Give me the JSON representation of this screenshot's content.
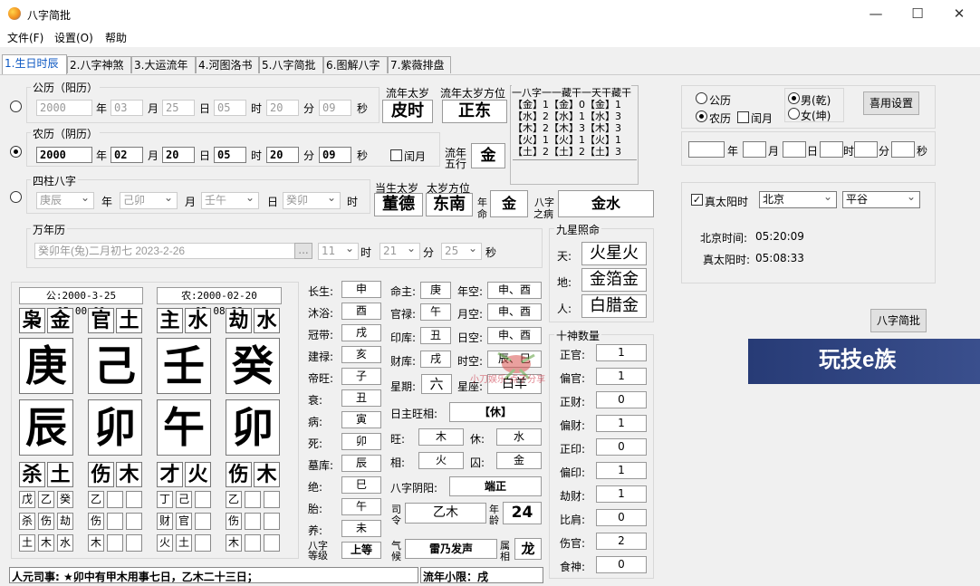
{
  "window": {
    "title": "八字简批",
    "min": "—",
    "max": "☐",
    "close": "✕"
  },
  "menu": [
    "文件(F)",
    "设置(O)",
    "帮助"
  ],
  "tabs": [
    "1.生日时辰",
    "2.八字神煞",
    "3.大运流年",
    "4.河图洛书",
    "5.八字简批",
    "6.图解八字",
    "7.紫薇排盘"
  ],
  "solar": {
    "title": "公历（阳历）",
    "year": "2000",
    "month": "03",
    "day": "25",
    "hour": "05",
    "minute": "20",
    "second": "09"
  },
  "lunar": {
    "title": "农历（阴历）",
    "year": "2000",
    "month": "02",
    "day": "20",
    "hour": "05",
    "minute": "20",
    "second": "09",
    "leap": "闰月"
  },
  "units": {
    "year": "年",
    "month": "月",
    "day": "日",
    "hour": "时",
    "minute": "分",
    "second": "秒"
  },
  "pillars_box": {
    "title": "四柱八字",
    "year": "庚辰",
    "month": "己卯",
    "day": "壬午",
    "hour": "癸卯"
  },
  "wannian": {
    "title": "万年历",
    "date": "癸卯年(兔)二月初七  2023-2-26",
    "ellipsis": "...",
    "hour": "11",
    "minute": "21",
    "second": "25"
  },
  "liunian": {
    "taisui_label": "流年太岁",
    "taisui": "皮时",
    "fangwei_label": "流年太岁方位",
    "fangwei": "正东",
    "wuxing_label1": "流年",
    "wuxing_label2": "五行",
    "wuxing": "金"
  },
  "canggan": {
    "header": "一八字一一藏干一天干藏干",
    "rows": [
      "【金】1【金】0【金】1",
      "【水】2【水】1【水】3",
      "【木】2【木】3【木】3",
      "【火】1【火】1【火】1",
      "【土】2【土】2【土】3"
    ]
  },
  "dangsheng": {
    "taisui_label": "当生太岁",
    "taisui": "董德",
    "fangwei_label": "太岁方位",
    "fangwei": "东南",
    "nianming_label1": "年",
    "nianming_label2": "命",
    "nianming": "金",
    "zhibing_label1": "八字",
    "zhibing_label2": "之病",
    "zhibing": "金水"
  },
  "right_settings": {
    "solar": "公历",
    "lunar": "农历",
    "leap": "闰月",
    "male": "男(乾)",
    "female": "女(坤)",
    "settings_btn": "喜用设置",
    "true_solar": "真太阳时",
    "city": "北京",
    "area": "平谷",
    "bj_label": "北京时间:",
    "bj_time": "05:20:09",
    "ts_label": "真太阳时:",
    "ts_time": "05:08:33",
    "brief_btn": "八字简批"
  },
  "ad": {
    "text": "玩技e族"
  },
  "chart": {
    "gong": "公:2000-3-25 05:00:00",
    "nong": "农:2000-02-20 05:08:33",
    "shishen_top": [
      [
        "枭",
        "金"
      ],
      [
        "官",
        "土"
      ],
      [
        "主",
        "水"
      ],
      [
        "劫",
        "水"
      ]
    ],
    "gan": [
      "庚",
      "己",
      "壬",
      "癸"
    ],
    "zhi": [
      "辰",
      "卯",
      "午",
      "卯"
    ],
    "shishen_bot": [
      [
        "杀",
        "土"
      ],
      [
        "伤",
        "木"
      ],
      [
        "才",
        "火"
      ],
      [
        "伤",
        "木"
      ]
    ],
    "hidden_row1": [
      [
        "戊",
        "乙",
        "癸"
      ],
      [
        "乙",
        "",
        ""
      ],
      [
        "丁",
        "己",
        ""
      ],
      [
        "乙",
        "",
        ""
      ]
    ],
    "hidden_row2": [
      [
        "杀",
        "伤",
        "劫"
      ],
      [
        "伤",
        "",
        ""
      ],
      [
        "财",
        "官",
        ""
      ],
      [
        "伤",
        "",
        ""
      ]
    ],
    "hidden_row3": [
      [
        "土",
        "木",
        "水"
      ],
      [
        "木",
        "",
        ""
      ],
      [
        "火",
        "土",
        ""
      ],
      [
        "木",
        "",
        ""
      ]
    ]
  },
  "changsheng": {
    "labels": [
      "长生:",
      "沐浴:",
      "冠带:",
      "建禄:",
      "帝旺:",
      "衰:",
      "病:",
      "死:",
      "墓库:",
      "绝:",
      "胎:",
      "养:"
    ],
    "values": [
      "申",
      "酉",
      "戌",
      "亥",
      "子",
      "丑",
      "寅",
      "卯",
      "辰",
      "巳",
      "午",
      "未"
    ],
    "dengji_label1": "八字",
    "dengji_label2": "等级",
    "dengji": "上等"
  },
  "mingzhu": {
    "mingzhu_label": "命主:",
    "mingzhu": "庚",
    "guanlu_label": "官禄:",
    "guanlu": "午",
    "yinku_label": "印库:",
    "yinku": "丑",
    "caiku_label": "财库:",
    "caiku": "戌",
    "niankong_label": "年空:",
    "niankong": "申、酉",
    "yuekong_label": "月空:",
    "yuekong": "申、酉",
    "rikong_label": "日空:",
    "rikong": "申、酉",
    "shikong_label": "时空:",
    "shikong": "辰、巳",
    "xingqi_label": "星期:",
    "xingqi": "六",
    "xingzuo_label": "星座:",
    "xingzuo": "白羊",
    "wangxiang_label": "日主旺相:",
    "wangxiang": "【休】",
    "wang_label": "旺:",
    "wang": "木",
    "xiu_label": "休:",
    "xiu": "水",
    "xiang_label": "相:",
    "xiang": "火",
    "qiu_label": "囚:",
    "qiu": "金",
    "yinyang_label": "八字阴阳:",
    "yinyang": "端正",
    "siling_label1": "司",
    "siling_label2": "令",
    "siling": "乙木",
    "nianling_label1": "年",
    "nianling_label2": "龄",
    "nianling": "24",
    "qihou_label1": "气",
    "qihou_label2": "候",
    "qihou": "雷乃发声",
    "shuxiang_label1": "属",
    "shuxiang_label2": "相",
    "shuxiang": "龙"
  },
  "jiuxing": {
    "title": "九星照命",
    "tian_label": "天:",
    "tian": "火星火",
    "di_label": "地:",
    "di": "金箔金",
    "ren_label": "人:",
    "ren": "白腊金"
  },
  "shishen_count": {
    "title": "十神数量",
    "labels": [
      "正官:",
      "偏官:",
      "正财:",
      "偏财:",
      "正印:",
      "偏印:",
      "劫财:",
      "比肩:",
      "伤官:",
      "食神:"
    ],
    "values": [
      "1",
      "1",
      "0",
      "1",
      "0",
      "1",
      "1",
      "0",
      "2",
      "0"
    ]
  },
  "bottom": {
    "siyuan": "人元司事:      ★卯中有甲木用事七日，乙木二十三日；",
    "xiaoxian": "流年小限：戌"
  },
  "watermark": "小刀娱乐 点子分享"
}
